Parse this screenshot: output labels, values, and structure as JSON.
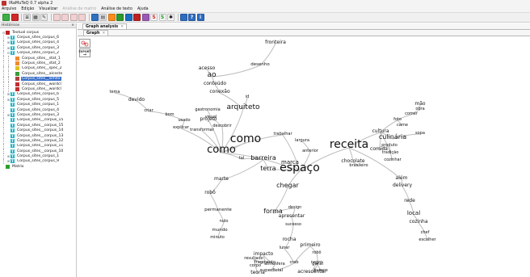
{
  "window": {
    "title": "IRaMuTeQ 0.7 alpha 2"
  },
  "menu": [
    {
      "label": "Arquivo",
      "enabled": true
    },
    {
      "label": "Edição",
      "enabled": true
    },
    {
      "label": "Visualizar",
      "enabled": true
    },
    {
      "label": "Análise de matriz",
      "enabled": false
    },
    {
      "label": "Análise de texto",
      "enabled": true
    },
    {
      "label": "Ajuda",
      "enabled": true
    }
  ],
  "toolbar": [
    {
      "icon": "open-corpus-icon",
      "color": "#3cb043",
      "glyph": ""
    },
    {
      "icon": "open-matrix-icon",
      "color": "#d22828",
      "glyph": ""
    },
    {
      "icon": "new-icon",
      "color": "#e8e8e8",
      "glyph": "≡"
    },
    {
      "icon": "chart-icon",
      "color": "#e8e8e8",
      "glyph": "▦"
    },
    {
      "icon": "edit-icon",
      "color": "#e8e8e8",
      "glyph": "✎"
    },
    {
      "icon": "matrix-tool-1-icon",
      "color": "#f0d0d0",
      "glyph": ""
    },
    {
      "icon": "matrix-tool-2-icon",
      "color": "#f0d0d0",
      "glyph": ""
    },
    {
      "icon": "matrix-tool-3-icon",
      "color": "#f0d0d0",
      "glyph": ""
    },
    {
      "icon": "matrix-tool-4-icon",
      "color": "#f0d0d0",
      "glyph": ""
    },
    {
      "icon": "stats-icon",
      "color": "#3070c0",
      "glyph": ""
    },
    {
      "icon": "spec-icon",
      "color": "#e8e8e8",
      "glyph": "▤"
    },
    {
      "icon": "chd-icon",
      "color": "#ff8c1a",
      "glyph": ""
    },
    {
      "icon": "afc-icon",
      "color": "#2c9a2c",
      "glyph": ""
    },
    {
      "icon": "similarity-icon",
      "color": "#1a6fc0",
      "glyph": ""
    },
    {
      "icon": "cloud-icon",
      "color": "#c02020",
      "glyph": ""
    },
    {
      "icon": "prototypical-icon",
      "color": "#9b59b6",
      "glyph": ""
    },
    {
      "icon": "s-red-icon",
      "color": "#f4f4f4",
      "glyph": "S",
      "text_color": "#d22828"
    },
    {
      "icon": "s-green-icon",
      "color": "#f4f4f4",
      "glyph": "S",
      "text_color": "#1d9a1d"
    },
    {
      "icon": "star-icon",
      "color": "#f4f4f4",
      "glyph": "✱",
      "text_color": "#111"
    },
    {
      "icon": "settings-icon",
      "color": "#2d6cc0",
      "glyph": ""
    },
    {
      "icon": "help-icon",
      "color": "#2d6cc0",
      "glyph": "?"
    },
    {
      "icon": "info-icon",
      "color": "#2d6cc0",
      "glyph": "i"
    }
  ],
  "left_panel": {
    "header": "Históricos",
    "tree": [
      {
        "depth": 0,
        "expander": "⊟",
        "icon": "textual-corpus-icon",
        "icon_color": "#c02020",
        "icon_glyph": "",
        "label": "Textual corpus",
        "selected": false
      },
      {
        "depth": 1,
        "expander": "⊞",
        "icon": "corpus-t-icon",
        "icon_color": "#1fb5c8",
        "icon_glyph": "T",
        "label": "Corpus_sites_corpus_6",
        "selected": false
      },
      {
        "depth": 1,
        "expander": "⊞",
        "icon": "corpus-t-icon",
        "icon_color": "#1fb5c8",
        "icon_glyph": "T",
        "label": "Corpus_sites_corpus_4",
        "selected": false
      },
      {
        "depth": 1,
        "expander": "⊞",
        "icon": "corpus-t-icon",
        "icon_color": "#1fb5c8",
        "icon_glyph": "T",
        "label": "Corpus_sites_corpus_3",
        "selected": false
      },
      {
        "depth": 1,
        "expander": "⊟",
        "icon": "corpus-t-icon",
        "icon_color": "#1fb5c8",
        "icon_glyph": "T",
        "label": "Corpus_sites_corpus_2",
        "selected": false
      },
      {
        "depth": 2,
        "expander": "",
        "icon": "stat-icon",
        "icon_color": "#f08a2c",
        "icon_glyph": "",
        "label": "Corpus_sites__stat_1",
        "selected": false
      },
      {
        "depth": 2,
        "expander": "",
        "icon": "stat-icon",
        "icon_color": "#f08a2c",
        "icon_glyph": "",
        "label": "Corpus_sites__stat_2",
        "selected": false
      },
      {
        "depth": 2,
        "expander": "",
        "icon": "spec-icon",
        "icon_color": "#e0c020",
        "icon_glyph": "",
        "label": "Corpus_sites__spec_2",
        "selected": false
      },
      {
        "depth": 2,
        "expander": "",
        "icon": "alceste-icon",
        "icon_color": "#3a9a3a",
        "icon_glyph": "",
        "label": "Corpus_sites__alceste",
        "selected": false
      },
      {
        "depth": 2,
        "expander": "",
        "icon": "simitxt-icon",
        "icon_color": "#b04040",
        "icon_glyph": "",
        "label": "Corpus_sites__simitx",
        "selected": true
      },
      {
        "depth": 2,
        "expander": "",
        "icon": "wordcloud-icon",
        "icon_color": "#c03030",
        "icon_glyph": "",
        "label": "Corpus_sites__wordcl",
        "selected": false
      },
      {
        "depth": 2,
        "expander": "",
        "icon": "wordcloud-icon",
        "icon_color": "#c03030",
        "icon_glyph": "",
        "label": "Corpus_sites__wordcl",
        "selected": false
      },
      {
        "depth": 1,
        "expander": "⊞",
        "icon": "corpus-t-icon",
        "icon_color": "#1fb5c8",
        "icon_glyph": "T",
        "label": "Corpus_sites_corpus_6",
        "selected": false
      },
      {
        "depth": 1,
        "expander": "⊞",
        "icon": "corpus-t-icon",
        "icon_color": "#1fb5c8",
        "icon_glyph": "T",
        "label": "Corpus_sites_corpus_5",
        "selected": false
      },
      {
        "depth": 1,
        "expander": "",
        "icon": "corpus-t-icon",
        "icon_color": "#1fb5c8",
        "icon_glyph": "T",
        "label": "Corpus_sites_corpus_1",
        "selected": false
      },
      {
        "depth": 1,
        "expander": "",
        "icon": "corpus-t-icon",
        "icon_color": "#1fb5c8",
        "icon_glyph": "T",
        "label": "Corpus_sites_corpus_4",
        "selected": false
      },
      {
        "depth": 1,
        "expander": "⊞",
        "icon": "corpus-t-icon",
        "icon_color": "#1fb5c8",
        "icon_glyph": "T",
        "label": "Corpus_sites_corpus_3",
        "selected": false
      },
      {
        "depth": 1,
        "expander": "",
        "icon": "corpus-t-icon",
        "icon_color": "#1fb5c8",
        "icon_glyph": "T",
        "label": "Corpus_sites__corpus_15",
        "selected": false
      },
      {
        "depth": 1,
        "expander": "",
        "icon": "corpus-t-icon",
        "icon_color": "#1fb5c8",
        "icon_glyph": "T",
        "label": "Corpus_sites__corpus_15",
        "selected": false
      },
      {
        "depth": 1,
        "expander": "",
        "icon": "corpus-t-icon",
        "icon_color": "#1fb5c8",
        "icon_glyph": "T",
        "label": "Corpus_sites__corpus_14",
        "selected": false
      },
      {
        "depth": 1,
        "expander": "",
        "icon": "corpus-t-icon",
        "icon_color": "#1fb5c8",
        "icon_glyph": "T",
        "label": "Corpus_sites__corpus_13",
        "selected": false
      },
      {
        "depth": 1,
        "expander": "",
        "icon": "corpus-t-icon",
        "icon_color": "#1fb5c8",
        "icon_glyph": "T",
        "label": "Corpus_sites__corpus_12",
        "selected": false
      },
      {
        "depth": 1,
        "expander": "",
        "icon": "corpus-t-icon",
        "icon_color": "#1fb5c8",
        "icon_glyph": "T",
        "label": "Corpus_sites__corpus_11",
        "selected": false
      },
      {
        "depth": 1,
        "expander": "",
        "icon": "corpus-t-icon",
        "icon_color": "#1fb5c8",
        "icon_glyph": "T",
        "label": "Corpus_sites__corpus_10",
        "selected": false
      },
      {
        "depth": 1,
        "expander": "⊞",
        "icon": "corpus-t-icon",
        "icon_color": "#1fb5c8",
        "icon_glyph": "T",
        "label": "Corpus_sites_corpus_1",
        "selected": false
      },
      {
        "depth": 1,
        "expander": "⊞",
        "icon": "corpus-t-icon",
        "icon_color": "#1fb5c8",
        "icon_glyph": "T",
        "label": "Corpus_sites_corpus_9",
        "selected": false
      },
      {
        "depth": 0,
        "expander": "",
        "icon": "matrix-icon",
        "icon_color": "#2ca02c",
        "icon_glyph": "",
        "label": "Matrix",
        "selected": false
      }
    ]
  },
  "tabs": {
    "main": {
      "label": "Graph analysis",
      "close": "×"
    },
    "sub": {
      "label": "Graph",
      "close": "×"
    }
  },
  "side_tools": {
    "export_label": "EXPORT"
  },
  "graph": {
    "nodes": [
      {
        "id": "fronteira",
        "label": "fronteira"
      },
      {
        "id": "desenho",
        "label": "desenho"
      },
      {
        "id": "acesso",
        "label": "acesso"
      },
      {
        "id": "ao",
        "label": "ao"
      },
      {
        "id": "conteudo",
        "label": "conteúdo"
      },
      {
        "id": "conexao",
        "label": "conexão"
      },
      {
        "id": "id",
        "label": "id"
      },
      {
        "id": "arquiteto",
        "label": "arquiteto"
      },
      {
        "id": "tema",
        "label": "tema"
      },
      {
        "id": "devido",
        "label": "devido"
      },
      {
        "id": "criar",
        "label": "criar"
      },
      {
        "id": "bom",
        "label": "bom"
      },
      {
        "id": "usado",
        "label": "usado"
      },
      {
        "id": "explicar",
        "label": "explicar"
      },
      {
        "id": "projeto",
        "label": "projeto"
      },
      {
        "id": "gastronomia",
        "label": "gastronomia"
      },
      {
        "id": "visual",
        "label": "visual"
      },
      {
        "id": "descobrir",
        "label": "descobrir"
      },
      {
        "id": "transformar",
        "label": "transformar"
      },
      {
        "id": "como",
        "label": "como"
      },
      {
        "id": "trabalhar",
        "label": "trabalhar"
      },
      {
        "id": "tal",
        "label": "tal"
      },
      {
        "id": "barreira",
        "label": "barreira"
      },
      {
        "id": "marte",
        "label": "marte"
      },
      {
        "id": "robo",
        "label": "robô"
      },
      {
        "id": "permanente",
        "label": "permanente"
      },
      {
        "id": "nulo",
        "label": "nulo"
      },
      {
        "id": "mundo",
        "label": "mundo"
      },
      {
        "id": "minuto",
        "label": "minuto"
      },
      {
        "id": "terra",
        "label": "terra"
      },
      {
        "id": "marca",
        "label": "marca"
      },
      {
        "id": "chegar",
        "label": "chegar"
      },
      {
        "id": "forma",
        "label": "forma"
      },
      {
        "id": "largura",
        "label": "largura"
      },
      {
        "id": "anterior",
        "label": "anterior"
      },
      {
        "id": "design",
        "label": "design"
      },
      {
        "id": "apresentar",
        "label": "apresentar"
      },
      {
        "id": "sucesso",
        "label": "sucesso"
      },
      {
        "id": "rocha",
        "label": "rocha"
      },
      {
        "id": "lunar",
        "label": "lunar"
      },
      {
        "id": "crab",
        "label": "crab"
      },
      {
        "id": "superficial",
        "label": "superficial"
      },
      {
        "id": "atmosfera",
        "label": "atmosfera"
      },
      {
        "id": "impacto",
        "label": "impacto"
      },
      {
        "id": "fragmento",
        "label": "fragmento"
      },
      {
        "id": "primeiro",
        "label": "primeiro"
      },
      {
        "id": "robo2",
        "label": "robô"
      },
      {
        "id": "geral",
        "label": "geral"
      },
      {
        "id": "acrescentar",
        "label": "acrescentar"
      },
      {
        "id": "resultado",
        "label": "resultado"
      },
      {
        "id": "corpo",
        "label": "corpo"
      },
      {
        "id": "teoria",
        "label": "teoria"
      },
      {
        "id": "negro",
        "label": "negro"
      },
      {
        "id": "buraco",
        "label": "buraco"
      },
      {
        "id": "choc",
        "label": "chocolate"
      },
      {
        "id": "brasileiro",
        "label": "brasileiro"
      },
      {
        "id": "alem",
        "label": "além"
      },
      {
        "id": "delivery",
        "label": "delivery"
      },
      {
        "id": "rede",
        "label": "rede"
      },
      {
        "id": "local",
        "label": "local"
      },
      {
        "id": "cozinha",
        "label": "cozinha"
      },
      {
        "id": "chef",
        "label": "chef"
      },
      {
        "id": "escolher",
        "label": "escolher"
      },
      {
        "id": "mao",
        "label": "mão"
      },
      {
        "id": "obra",
        "label": "obra"
      },
      {
        "id": "comer",
        "label": "comer"
      },
      {
        "id": "foto",
        "label": "foto"
      },
      {
        "id": "carne",
        "label": "carne"
      },
      {
        "id": "cultura",
        "label": "cultura"
      },
      {
        "id": "culinaria",
        "label": "culinária"
      },
      {
        "id": "sopa",
        "label": "sopa"
      },
      {
        "id": "comida",
        "label": "comida"
      },
      {
        "id": "produto",
        "label": "produto"
      },
      {
        "id": "tradicao",
        "label": "tradição"
      },
      {
        "id": "cozinhar",
        "label": "cozinhar"
      },
      {
        "id": "hub_left",
        "label": "como"
      },
      {
        "id": "hub_mid",
        "label": "espaço"
      },
      {
        "id": "hub_right",
        "label": "receita"
      }
    ],
    "edges": [
      [
        "fronteira",
        "desenho"
      ],
      [
        "desenho",
        "ao"
      ],
      [
        "acesso",
        "ao"
      ],
      [
        "ao",
        "conteudo"
      ],
      [
        "conteudo",
        "conexao"
      ],
      [
        "conexao",
        "arquiteto"
      ],
      [
        "id",
        "arquiteto"
      ],
      [
        "arquiteto",
        "hub_left"
      ],
      [
        "tema",
        "devido"
      ],
      [
        "devido",
        "criar"
      ],
      [
        "criar",
        "bom"
      ],
      [
        "bom",
        "usado"
      ],
      [
        "usado",
        "explicar"
      ],
      [
        "explicar",
        "hub_left"
      ],
      [
        "projeto",
        "hub_left"
      ],
      [
        "gastronomia",
        "visual"
      ],
      [
        "visual",
        "descobrir"
      ],
      [
        "descobrir",
        "hub_left"
      ],
      [
        "transformar",
        "hub_left"
      ],
      [
        "como",
        "hub_left"
      ],
      [
        "hub_left",
        "trabalhar"
      ],
      [
        "hub_left",
        "tal"
      ],
      [
        "tal",
        "barreira"
      ],
      [
        "barreira",
        "marte"
      ],
      [
        "marte",
        "robo"
      ],
      [
        "robo",
        "permanente"
      ],
      [
        "permanente",
        "nulo"
      ],
      [
        "nulo",
        "mundo"
      ],
      [
        "mundo",
        "minuto"
      ],
      [
        "hub_left",
        "hub_mid"
      ],
      [
        "trabalhar",
        "hub_mid"
      ],
      [
        "barreira",
        "terra"
      ],
      [
        "terra",
        "hub_mid"
      ],
      [
        "marca",
        "hub_mid"
      ],
      [
        "chegar",
        "hub_mid"
      ],
      [
        "chegar",
        "forma"
      ],
      [
        "largura",
        "anterior"
      ],
      [
        "anterior",
        "hub_mid"
      ],
      [
        "forma",
        "design"
      ],
      [
        "design",
        "apresentar"
      ],
      [
        "apresentar",
        "sucesso"
      ],
      [
        "sucesso",
        "rocha"
      ],
      [
        "rocha",
        "lunar"
      ],
      [
        "lunar",
        "crab"
      ],
      [
        "crab",
        "superficial"
      ],
      [
        "superficial",
        "atmosfera"
      ],
      [
        "atmosfera",
        "impacto"
      ],
      [
        "impacto",
        "fragmento"
      ],
      [
        "crab",
        "primeiro"
      ],
      [
        "primeiro",
        "robo2"
      ],
      [
        "robo2",
        "geral"
      ],
      [
        "geral",
        "acrescentar"
      ],
      [
        "fragmento",
        "resultado"
      ],
      [
        "resultado",
        "corpo"
      ],
      [
        "corpo",
        "teoria"
      ],
      [
        "acrescentar",
        "negro"
      ],
      [
        "negro",
        "buraco"
      ],
      [
        "hub_mid",
        "hub_right"
      ],
      [
        "hub_right",
        "choc"
      ],
      [
        "choc",
        "brasileiro"
      ],
      [
        "hub_right",
        "alem"
      ],
      [
        "alem",
        "delivery"
      ],
      [
        "delivery",
        "rede"
      ],
      [
        "rede",
        "local"
      ],
      [
        "local",
        "cozinha"
      ],
      [
        "cozinha",
        "chef"
      ],
      [
        "chef",
        "escolher"
      ],
      [
        "hub_right",
        "cultura"
      ],
      [
        "cultura",
        "culinaria"
      ],
      [
        "culinaria",
        "sopa"
      ],
      [
        "cultura",
        "comida"
      ],
      [
        "comida",
        "produto"
      ],
      [
        "produto",
        "tradicao"
      ],
      [
        "cultura",
        "cozinhar"
      ],
      [
        "cultura",
        "foto"
      ],
      [
        "foto",
        "carne"
      ],
      [
        "foto",
        "comer"
      ],
      [
        "comer",
        "obra"
      ],
      [
        "obra",
        "mao"
      ]
    ]
  }
}
